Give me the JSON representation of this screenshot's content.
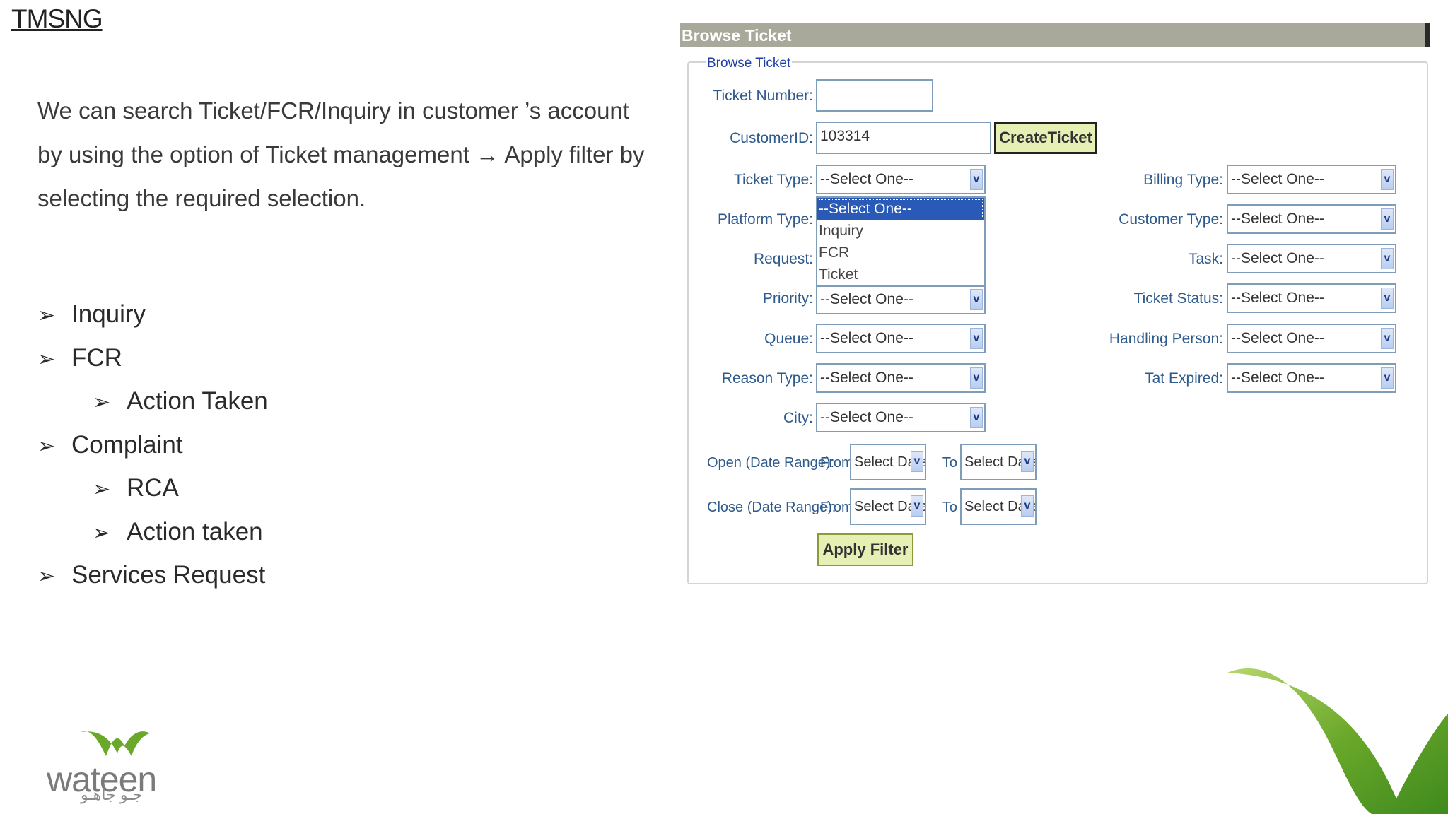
{
  "slide": {
    "title": "TMSNG",
    "intro": "We can search Ticket/FCR/Inquiry in customer ’s account by using the option of Ticket management → Apply filter by selecting the required selection.",
    "bullet_glyph": "➢",
    "bullets": [
      {
        "text": "Inquiry",
        "level": 1
      },
      {
        "text": "FCR",
        "level": 1
      },
      {
        "text": "Action Taken",
        "level": 2
      },
      {
        "text": "Complaint",
        "level": 1
      },
      {
        "text": "RCA",
        "level": 2
      },
      {
        "text": "Action taken",
        "level": 2
      },
      {
        "text": "Services Request",
        "level": 1
      }
    ]
  },
  "panel": {
    "header": "Browse Ticket",
    "legend": "Browse Ticket",
    "ticket_number_label": "Ticket Number:",
    "ticket_number_value": "",
    "customer_id_label": "CustomerID:",
    "customer_id_value": "103314",
    "create_ticket_button": "CreateTicket",
    "select_placeholder": "--Select One--",
    "left_fields": [
      {
        "label": "Ticket Type:",
        "value": "--Select One--"
      },
      {
        "label": "Platform Type:",
        "value": "--Select One--"
      },
      {
        "label": "Request:",
        "value": "--Select One--"
      },
      {
        "label": "Priority:",
        "value": "--Select One--"
      },
      {
        "label": "Queue:",
        "value": "--Select One--"
      },
      {
        "label": "Reason Type:",
        "value": "--Select One--"
      },
      {
        "label": "City:",
        "value": "--Select One--"
      }
    ],
    "right_fields": [
      {
        "label": "Billing Type:",
        "value": "--Select One--"
      },
      {
        "label": "Customer Type:",
        "value": "--Select One--"
      },
      {
        "label": "Task:",
        "value": "--Select One--"
      },
      {
        "label": "Ticket Status:",
        "value": "--Select One--"
      },
      {
        "label": "Handling Person:",
        "value": "--Select One--"
      },
      {
        "label": "Tat Expired:",
        "value": "--Select One--"
      }
    ],
    "ticket_type_options": [
      "--Select One--",
      "Inquiry",
      "FCR",
      "Ticket"
    ],
    "open_range_label": "Open (Date Range):",
    "close_range_label": "Close (Date Range):",
    "from_label": "From",
    "to_label": "To",
    "date_placeholder": "Select Date",
    "apply_filter_button": "Apply Filter",
    "dropdown_glyph": "v"
  },
  "logo": {
    "wordmark": "wateen",
    "arabic": "جـو جاهـو"
  },
  "colors": {
    "header_bg": "#a8a99a",
    "label_blue": "#2e5a8c",
    "button_bg": "#e6f0b4",
    "selected_option": "#2a5ab8",
    "brand_green": "#6aa82a"
  }
}
